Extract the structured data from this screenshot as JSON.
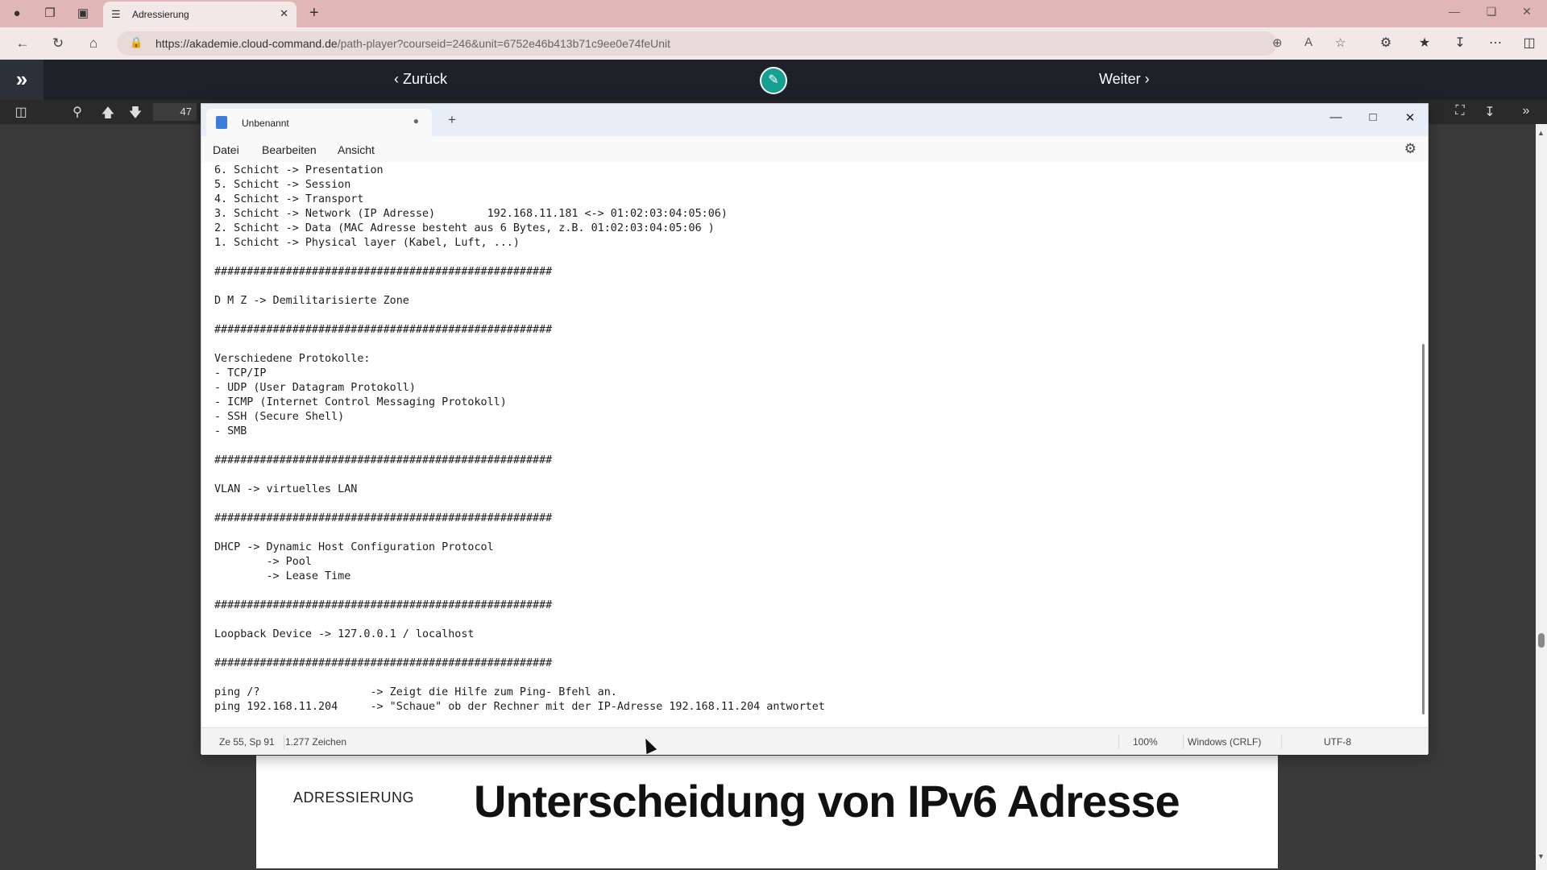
{
  "browser": {
    "tab_title": "Adressierung",
    "url_host": "https://akademie.cloud-command.de",
    "url_path": "/path-player?courseid=246&unit=6752e46b413b71c9ee0e74feUnit"
  },
  "course": {
    "back_label": "‹ Zurück",
    "next_label": "Weiter ›"
  },
  "pdf": {
    "page_number": "47",
    "section_label": "ADRESSIERUNG",
    "slide_heading": "Unterscheidung von IPv6 Adresse"
  },
  "notepad": {
    "tab_name": "Unbenannt",
    "menu": {
      "file": "Datei",
      "edit": "Bearbeiten",
      "view": "Ansicht"
    },
    "content": "6. Schicht -> Presentation\n5. Schicht -> Session\n4. Schicht -> Transport\n3. Schicht -> Network (IP Adresse)        192.168.11.181 <-> 01:02:03:04:05:06)\n2. Schicht -> Data (MAC Adresse besteht aus 6 Bytes, z.B. 01:02:03:04:05:06 )\n1. Schicht -> Physical layer (Kabel, Luft, ...)\n\n####################################################\n\nD M Z -> Demilitarisierte Zone\n\n####################################################\n\nVerschiedene Protokolle:\n- TCP/IP\n- UDP (User Datagram Protokoll)\n- ICMP (Internet Control Messaging Protokoll)\n- SSH (Secure Shell)\n- SMB\n\n####################################################\n\nVLAN -> virtuelles LAN\n\n####################################################\n\nDHCP -> Dynamic Host Configuration Protocol\n        -> Pool\n        -> Lease Time\n\n####################################################\n\nLoopback Device -> 127.0.0.1 / localhost\n\n####################################################\n\nping /?                 -> Zeigt die Hilfe zum Ping- Bfehl an.\nping 192.168.11.204     -> \"Schaue\" ob der Rechner mit der IP-Adresse 192.168.11.204 antwortet",
    "status": {
      "position": "Ze 55, Sp 91",
      "chars": "1.277 Zeichen",
      "zoom": "100%",
      "line_ending": "Windows (CRLF)",
      "encoding": "UTF-8"
    }
  },
  "icons": [
    "profile-icon",
    "collections-icon",
    "tab-actions-icon",
    "tab-favicon-icon",
    "tab-close-icon",
    "new-tab-icon",
    "minimize-icon",
    "restore-icon",
    "close-icon",
    "back-icon",
    "refresh-icon",
    "home-icon",
    "lock-icon",
    "zoom-icon",
    "read-aloud-icon",
    "favorite-icon",
    "extensions-icon",
    "favorites-icon",
    "downloads-icon",
    "more-icon",
    "sidebar-icon",
    "expand-icon",
    "edit-icon",
    "sidebar-toggle-icon",
    "search-icon",
    "up-arrow-icon",
    "down-arrow-icon",
    "fullscreen-icon",
    "download-icon",
    "more-tools-icon",
    "notepad-icon",
    "settings-gear-icon"
  ],
  "colors": {
    "browser_frame": "#e0b6b6",
    "course_header": "#1e2228",
    "edit_button": "#16a092",
    "notepad_title": "#e7eef7"
  }
}
